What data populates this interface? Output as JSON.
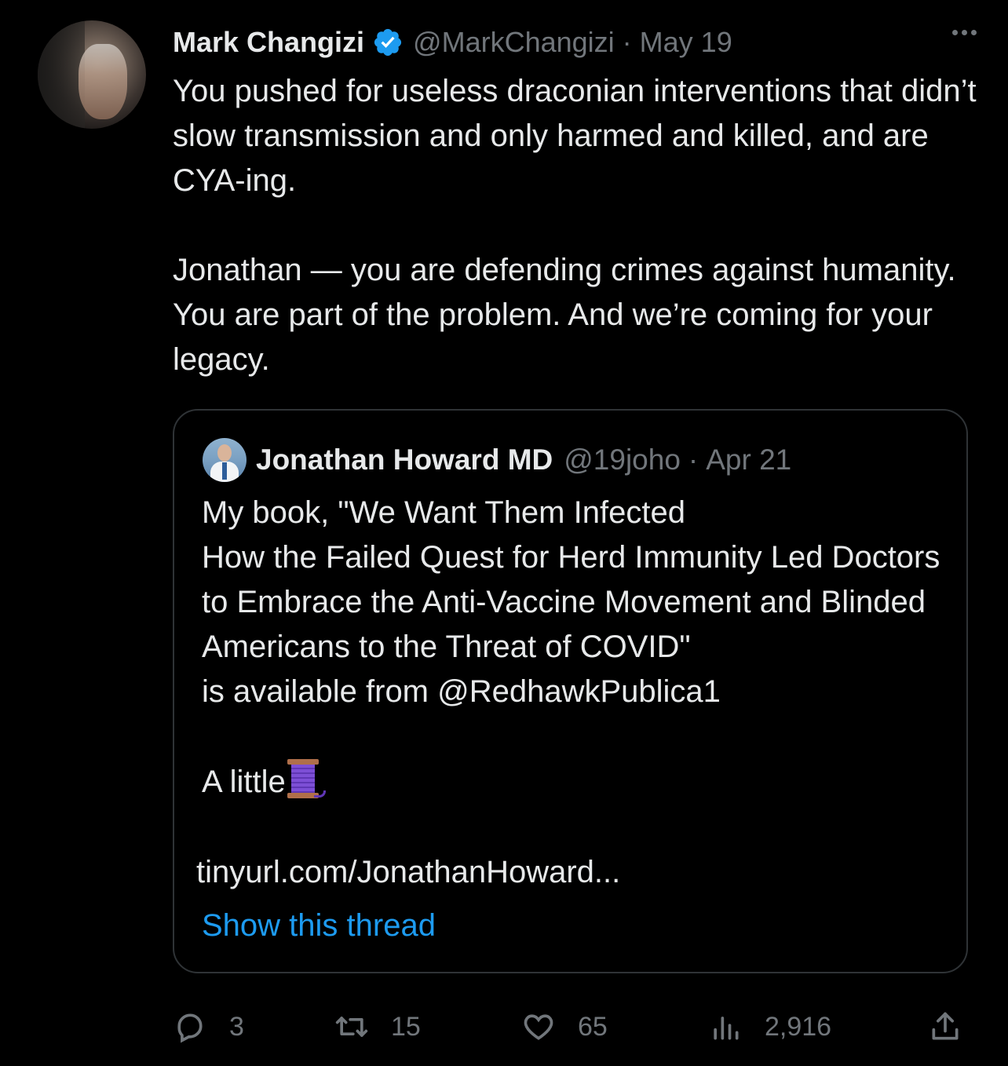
{
  "tweet": {
    "author_name": "Mark Changizi",
    "handle": "@MarkChangizi",
    "date": "May 19",
    "separator": "·",
    "verified_icon": "verified-badge-icon",
    "text": "You pushed for useless draconian interventions that didn’t slow transmission and only harmed and killed, and are CYA-ing.\n\nJonathan — you are defending crimes against humanity. You are part of the problem. And we’re coming for your legacy."
  },
  "quoted_tweet": {
    "author_name": "Jonathan Howard MD",
    "handle": "@19joho",
    "date": "Apr 21",
    "separator": "·",
    "text": "My book, \"We Want Them Infected\nHow the Failed Quest for Herd Immunity Led Doctors to Embrace the Anti-Vaccine Movement and Blinded Americans to the Threat of COVID\"\nis available from @RedhawkPublica1\n\n",
    "text_line2": "A little",
    "emoji": "thread-spool-emoji",
    "link": "tinyurl.com/JonathanHoward...",
    "show_thread": "Show this thread"
  },
  "actions": {
    "replies": "3",
    "retweets": "15",
    "likes": "65",
    "views": "2,916"
  },
  "colors": {
    "background": "#000000",
    "text": "#e7e9ea",
    "muted": "#71767b",
    "accent": "#1d9bf0",
    "border": "#2f3336"
  }
}
